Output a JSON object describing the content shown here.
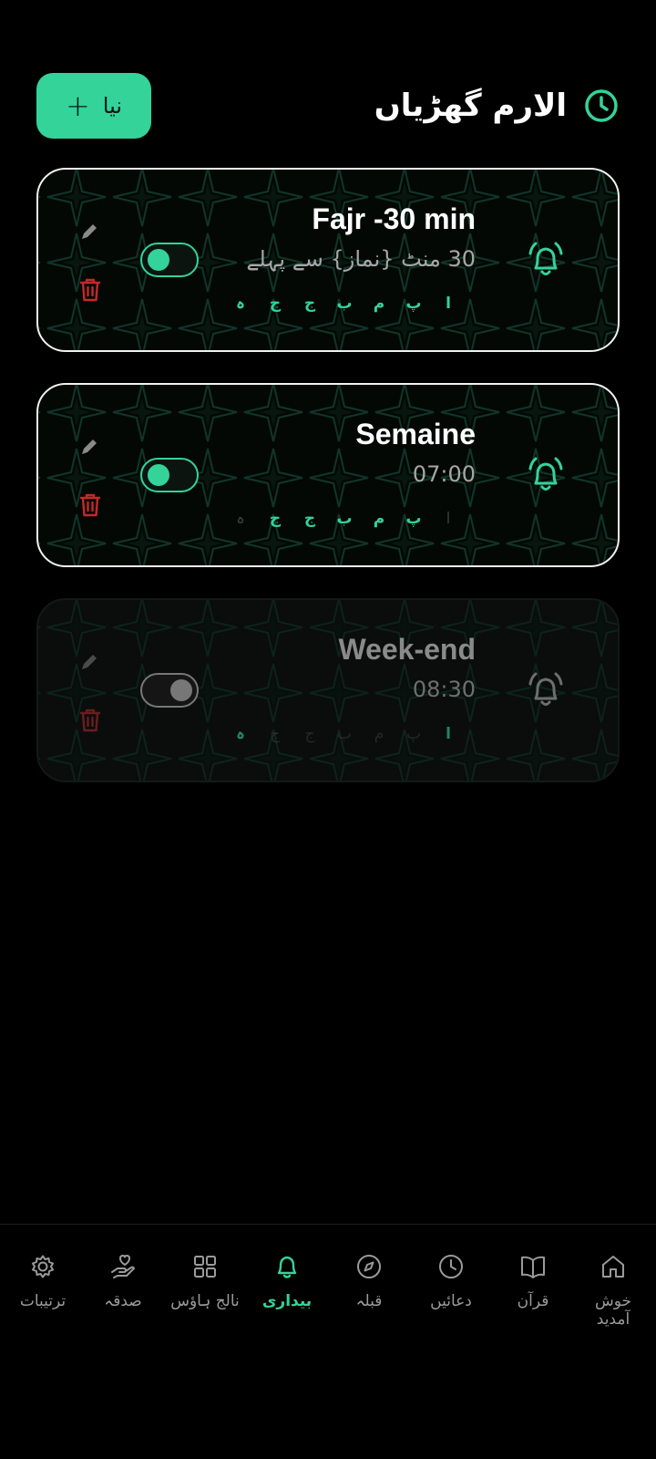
{
  "header": {
    "title": "الارم گھڑیاں",
    "new_button_label": "نیا",
    "new_button_symbol": "+",
    "icon": "clock-icon"
  },
  "colors": {
    "accent": "#34d399",
    "background": "#000000",
    "danger": "#dc2626",
    "muted_text": "#a6a6a6"
  },
  "alarms": [
    {
      "name": "Fajr -30 min",
      "subtitle": "30 منٹ {نماز} سے پہلے",
      "enabled": true,
      "days": [
        {
          "label": "ا",
          "active": true
        },
        {
          "label": "پ",
          "active": true
        },
        {
          "label": "م",
          "active": true
        },
        {
          "label": "ب",
          "active": true
        },
        {
          "label": "ج",
          "active": true
        },
        {
          "label": "ج",
          "active": true
        },
        {
          "label": "ہ",
          "active": true
        }
      ]
    },
    {
      "name": "Semaine",
      "subtitle": "07:00",
      "enabled": true,
      "days": [
        {
          "label": "ا",
          "active": false
        },
        {
          "label": "پ",
          "active": true
        },
        {
          "label": "م",
          "active": true
        },
        {
          "label": "ب",
          "active": true
        },
        {
          "label": "ج",
          "active": true
        },
        {
          "label": "ج",
          "active": true
        },
        {
          "label": "ہ",
          "active": false
        }
      ]
    },
    {
      "name": "Week-end",
      "subtitle": "08:30",
      "enabled": false,
      "days": [
        {
          "label": "ا",
          "active": true
        },
        {
          "label": "پ",
          "active": false
        },
        {
          "label": "م",
          "active": false
        },
        {
          "label": "ب",
          "active": false
        },
        {
          "label": "ج",
          "active": false
        },
        {
          "label": "ج",
          "active": false
        },
        {
          "label": "ہ",
          "active": true
        }
      ]
    }
  ],
  "nav": {
    "items": [
      {
        "label": "ترتیبات",
        "icon": "settings-icon",
        "active": false
      },
      {
        "label": "صدقہ",
        "icon": "charity-icon",
        "active": false
      },
      {
        "label": "نالج ہاؤس",
        "icon": "grid-icon",
        "active": false
      },
      {
        "label": "بیداری",
        "icon": "bell-icon",
        "active": true
      },
      {
        "label": "قبلہ",
        "icon": "compass-icon",
        "active": false
      },
      {
        "label": "دعائیں",
        "icon": "clock-icon",
        "active": false
      },
      {
        "label": "قرآن",
        "icon": "book-icon",
        "active": false
      },
      {
        "label": "خوش آمدید",
        "icon": "home-icon",
        "active": false
      }
    ]
  }
}
